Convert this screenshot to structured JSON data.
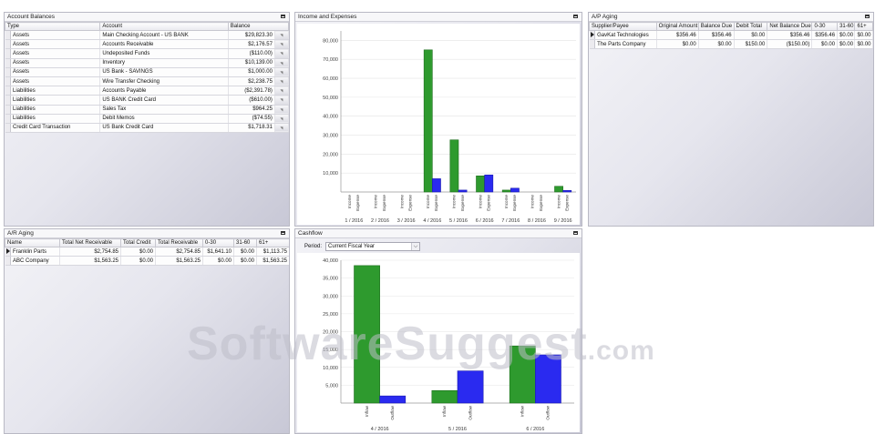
{
  "account_balances": {
    "title": "Account Balances",
    "columns": [
      "Type",
      "Account",
      "Balance"
    ],
    "rows": [
      [
        "Assets",
        "Main Checking Account - US BANK",
        "$29,823.30"
      ],
      [
        "Assets",
        "Accounts Receivable",
        "$2,176.57"
      ],
      [
        "Assets",
        "Undeposited Funds",
        "($110.00)"
      ],
      [
        "Assets",
        "Inventory",
        "$10,139.00"
      ],
      [
        "Assets",
        "US Bank - SAVINGS",
        "$1,000.00"
      ],
      [
        "Assets",
        "Wire Transfer Checking",
        "$2,238.75"
      ],
      [
        "Liabilities",
        "Accounts Payable",
        "($2,391.78)"
      ],
      [
        "Liabilities",
        "US BANK Credit Card",
        "($610.00)"
      ],
      [
        "Liabilities",
        "Sales Tax",
        "$964.25"
      ],
      [
        "Liabilities",
        "Debit Memos",
        "($74.55)"
      ],
      [
        "Credit Card Transaction",
        "US Bank Credit Card",
        "$1,718.31"
      ]
    ]
  },
  "income_expenses": {
    "title": "Income and Expenses"
  },
  "ap_aging": {
    "title": "A/P Aging",
    "columns": [
      "Supplier/Payee",
      "Original Amount",
      "Balance Due",
      "Debit Total",
      "Net Balance Due",
      "0-30",
      "31-60",
      "61+"
    ],
    "rows": [
      [
        "GavKat Technologies",
        "$356.46",
        "$356.46",
        "$0.00",
        "$356.46",
        "$356.46",
        "$0.00",
        "$0.00"
      ],
      [
        "The Parts Company",
        "$0.00",
        "$0.00",
        "$150.00",
        "($150.00)",
        "$0.00",
        "$0.00",
        "$0.00"
      ]
    ]
  },
  "ar_aging": {
    "title": "A/R Aging",
    "columns": [
      "Name",
      "Total Net Receivable",
      "Total Credit",
      "Total Receivable",
      "0-30",
      "31-60",
      "61+"
    ],
    "rows": [
      [
        "Franklin Parts",
        "$2,754.85",
        "$0.00",
        "$2,754.85",
        "$1,641.10",
        "$0.00",
        "$1,113.75"
      ],
      [
        "ABC Company",
        "$1,563.25",
        "$0.00",
        "$1,563.25",
        "$0.00",
        "$0.00",
        "$1,563.25"
      ]
    ]
  },
  "cashflow": {
    "title": "Cashflow",
    "period_label": "Period:",
    "period_value": "Current Fiscal Year"
  },
  "watermark": {
    "main": "SoftwareSuggest",
    "suffix": ".com"
  },
  "colors": {
    "income": "#2e9a2e",
    "expense": "#2a2af0",
    "panel_border": "#b9b9c4"
  },
  "chart_data": [
    {
      "type": "bar",
      "categories": [
        "1 / 2016",
        "2 / 2016",
        "3 / 2016",
        "4 / 2016",
        "5 / 2016",
        "6 / 2016",
        "7 / 2016",
        "8 / 2016",
        "9 / 2016"
      ],
      "bar_labels": [
        "Income",
        "Expense"
      ],
      "series": [
        {
          "name": "Income",
          "values": [
            0,
            0,
            0,
            75000,
            27500,
            8500,
            1000,
            0,
            3000
          ]
        },
        {
          "name": "Expense",
          "values": [
            0,
            0,
            0,
            7000,
            1000,
            9000,
            2000,
            0,
            800
          ]
        }
      ],
      "ylim": [
        0,
        85000
      ],
      "yticks": [
        10000,
        20000,
        30000,
        40000,
        50000,
        60000,
        70000,
        80000
      ],
      "ytick_labels": [
        "10,000",
        "20,000",
        "30,000",
        "40,000",
        "50,000",
        "60,000",
        "70,000",
        "80,000"
      ]
    },
    {
      "type": "bar",
      "categories": [
        "4 / 2016",
        "5 / 2016",
        "6 / 2016"
      ],
      "bar_labels": [
        "Inflow",
        "Outflow"
      ],
      "series": [
        {
          "name": "Inflow",
          "values": [
            38500,
            3500,
            16000
          ]
        },
        {
          "name": "Outflow",
          "values": [
            2000,
            9000,
            13500
          ]
        }
      ],
      "ylim": [
        0,
        40000
      ],
      "yticks": [
        5000,
        10000,
        15000,
        20000,
        25000,
        30000,
        35000,
        40000
      ],
      "ytick_labels": [
        "5,000",
        "10,000",
        "15,000",
        "20,000",
        "25,000",
        "30,000",
        "35,000",
        "40,000"
      ]
    }
  ]
}
